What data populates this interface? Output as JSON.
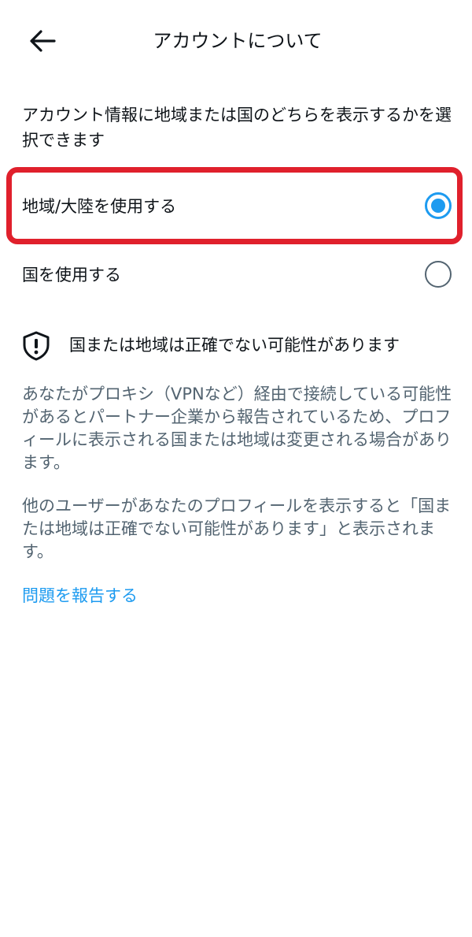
{
  "header": {
    "title": "アカウントについて",
    "back_icon": "arrow-left-icon"
  },
  "description": "アカウント情報に地域または国のどちらを表示するかを選択できます",
  "options": [
    {
      "label": "地域/大陸を使用する",
      "selected": true
    },
    {
      "label": "国を使用する",
      "selected": false
    }
  ],
  "warning": {
    "icon": "shield-exclamation-icon",
    "title": "国または地域は正確でない可能性があります"
  },
  "paragraphs": [
    "あなたがプロキシ（VPNなど）経由で接続している可能性があるとパートナー企業から報告されているため、プロフィールに表示される国または地域は変更される場合があります。",
    "他のユーザーがあなたのプロフィールを表示すると「国または地域は正確でない可能性があります」と表示されます。"
  ],
  "report_link": "問題を報告する",
  "colors": {
    "accent": "#1d9bf0",
    "highlight": "#e0202c",
    "text_primary": "#0f1419",
    "text_secondary": "#536471"
  }
}
